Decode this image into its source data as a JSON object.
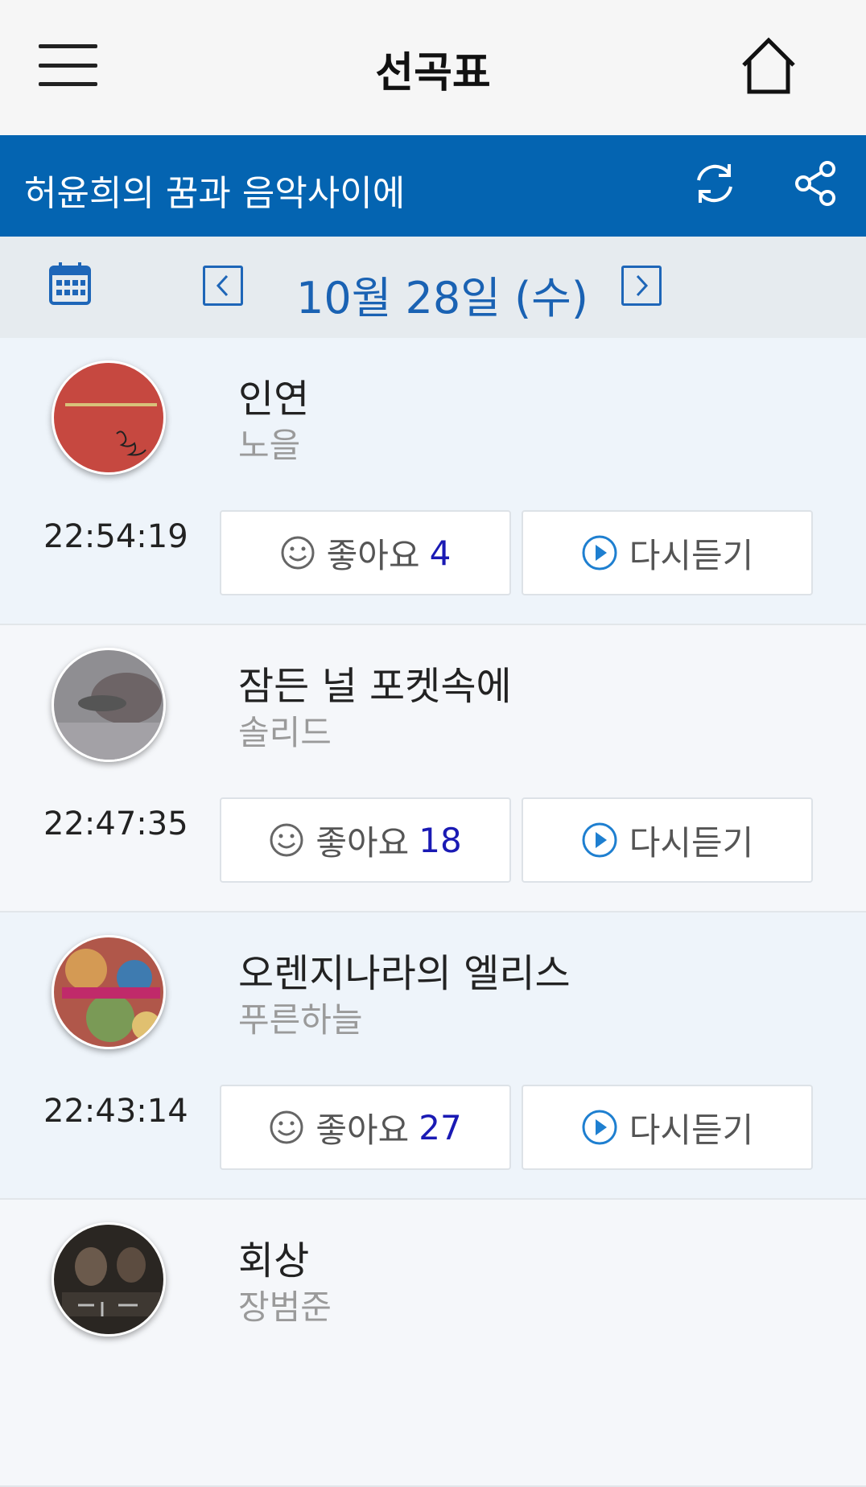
{
  "header": {
    "title": "선곡표"
  },
  "program": {
    "name": "허윤희의 꿈과 음악사이에"
  },
  "datebar": {
    "date": "10월 28일 (수)"
  },
  "colors": {
    "brand_blue": "#0464b1",
    "accent_blue": "#1a62b3",
    "count_blue": "#1a1ab4"
  },
  "songs": [
    {
      "title": "인연",
      "artist": "노을",
      "time": "22:54:19",
      "like_label": "좋아요",
      "likes": "4",
      "replay_label": "다시듣기"
    },
    {
      "title": "잠든 널 포켓속에",
      "artist": "솔리드",
      "time": "22:47:35",
      "like_label": "좋아요",
      "likes": "18",
      "replay_label": "다시듣기"
    },
    {
      "title": "오렌지나라의 엘리스",
      "artist": "푸른하늘",
      "time": "22:43:14",
      "like_label": "좋아요",
      "likes": "27",
      "replay_label": "다시듣기"
    },
    {
      "title": "회상",
      "artist": "장범준"
    }
  ]
}
